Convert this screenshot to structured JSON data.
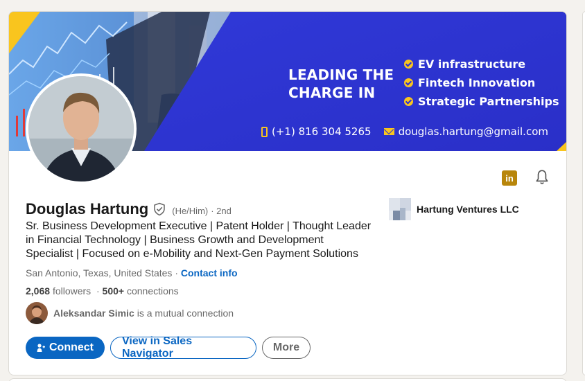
{
  "banner": {
    "headline_line1": "LEADING THE",
    "headline_line2": "CHARGE IN",
    "focus_areas": [
      "EV infrastructure",
      "Fintech Innovation",
      "Strategic Partnerships"
    ],
    "phone": "(+1) 816 304 5265",
    "email": "douglas.hartung@gmail.com",
    "colors": {
      "blue": "#2b2fd6",
      "yellow": "#f9c51e"
    }
  },
  "profile": {
    "name": "Douglas Hartung",
    "pronouns": "(He/Him)",
    "degree": "· 2nd",
    "headline": "Sr. Business Development Executive | Patent Holder | Thought Leader in Financial Technology | Business Growth and Development Specialist | Focused on e-Mobility and Next-Gen Payment Solutions",
    "location": "San Antonio, Texas, United States",
    "location_separator": " · ",
    "contact_info_label": "Contact info",
    "followers_count": "2,068",
    "followers_label": "followers",
    "connections_separator": "·",
    "connections_count": "500+",
    "connections_label": "connections",
    "mutual_name": "Aleksandar Simic",
    "mutual_text": "is a mutual connection"
  },
  "company": {
    "name": "Hartung Ventures LLC"
  },
  "icons": {
    "linkedin": "linkedin-icon",
    "bell": "bell-icon",
    "verified": "verified-shield-icon"
  },
  "actions": {
    "connect_label": "Connect",
    "sales_navigator_label": "View in Sales Navigator",
    "more_label": "More"
  },
  "linkedin_badge_text": "in",
  "theme": {
    "primary": "#0a66c2"
  }
}
